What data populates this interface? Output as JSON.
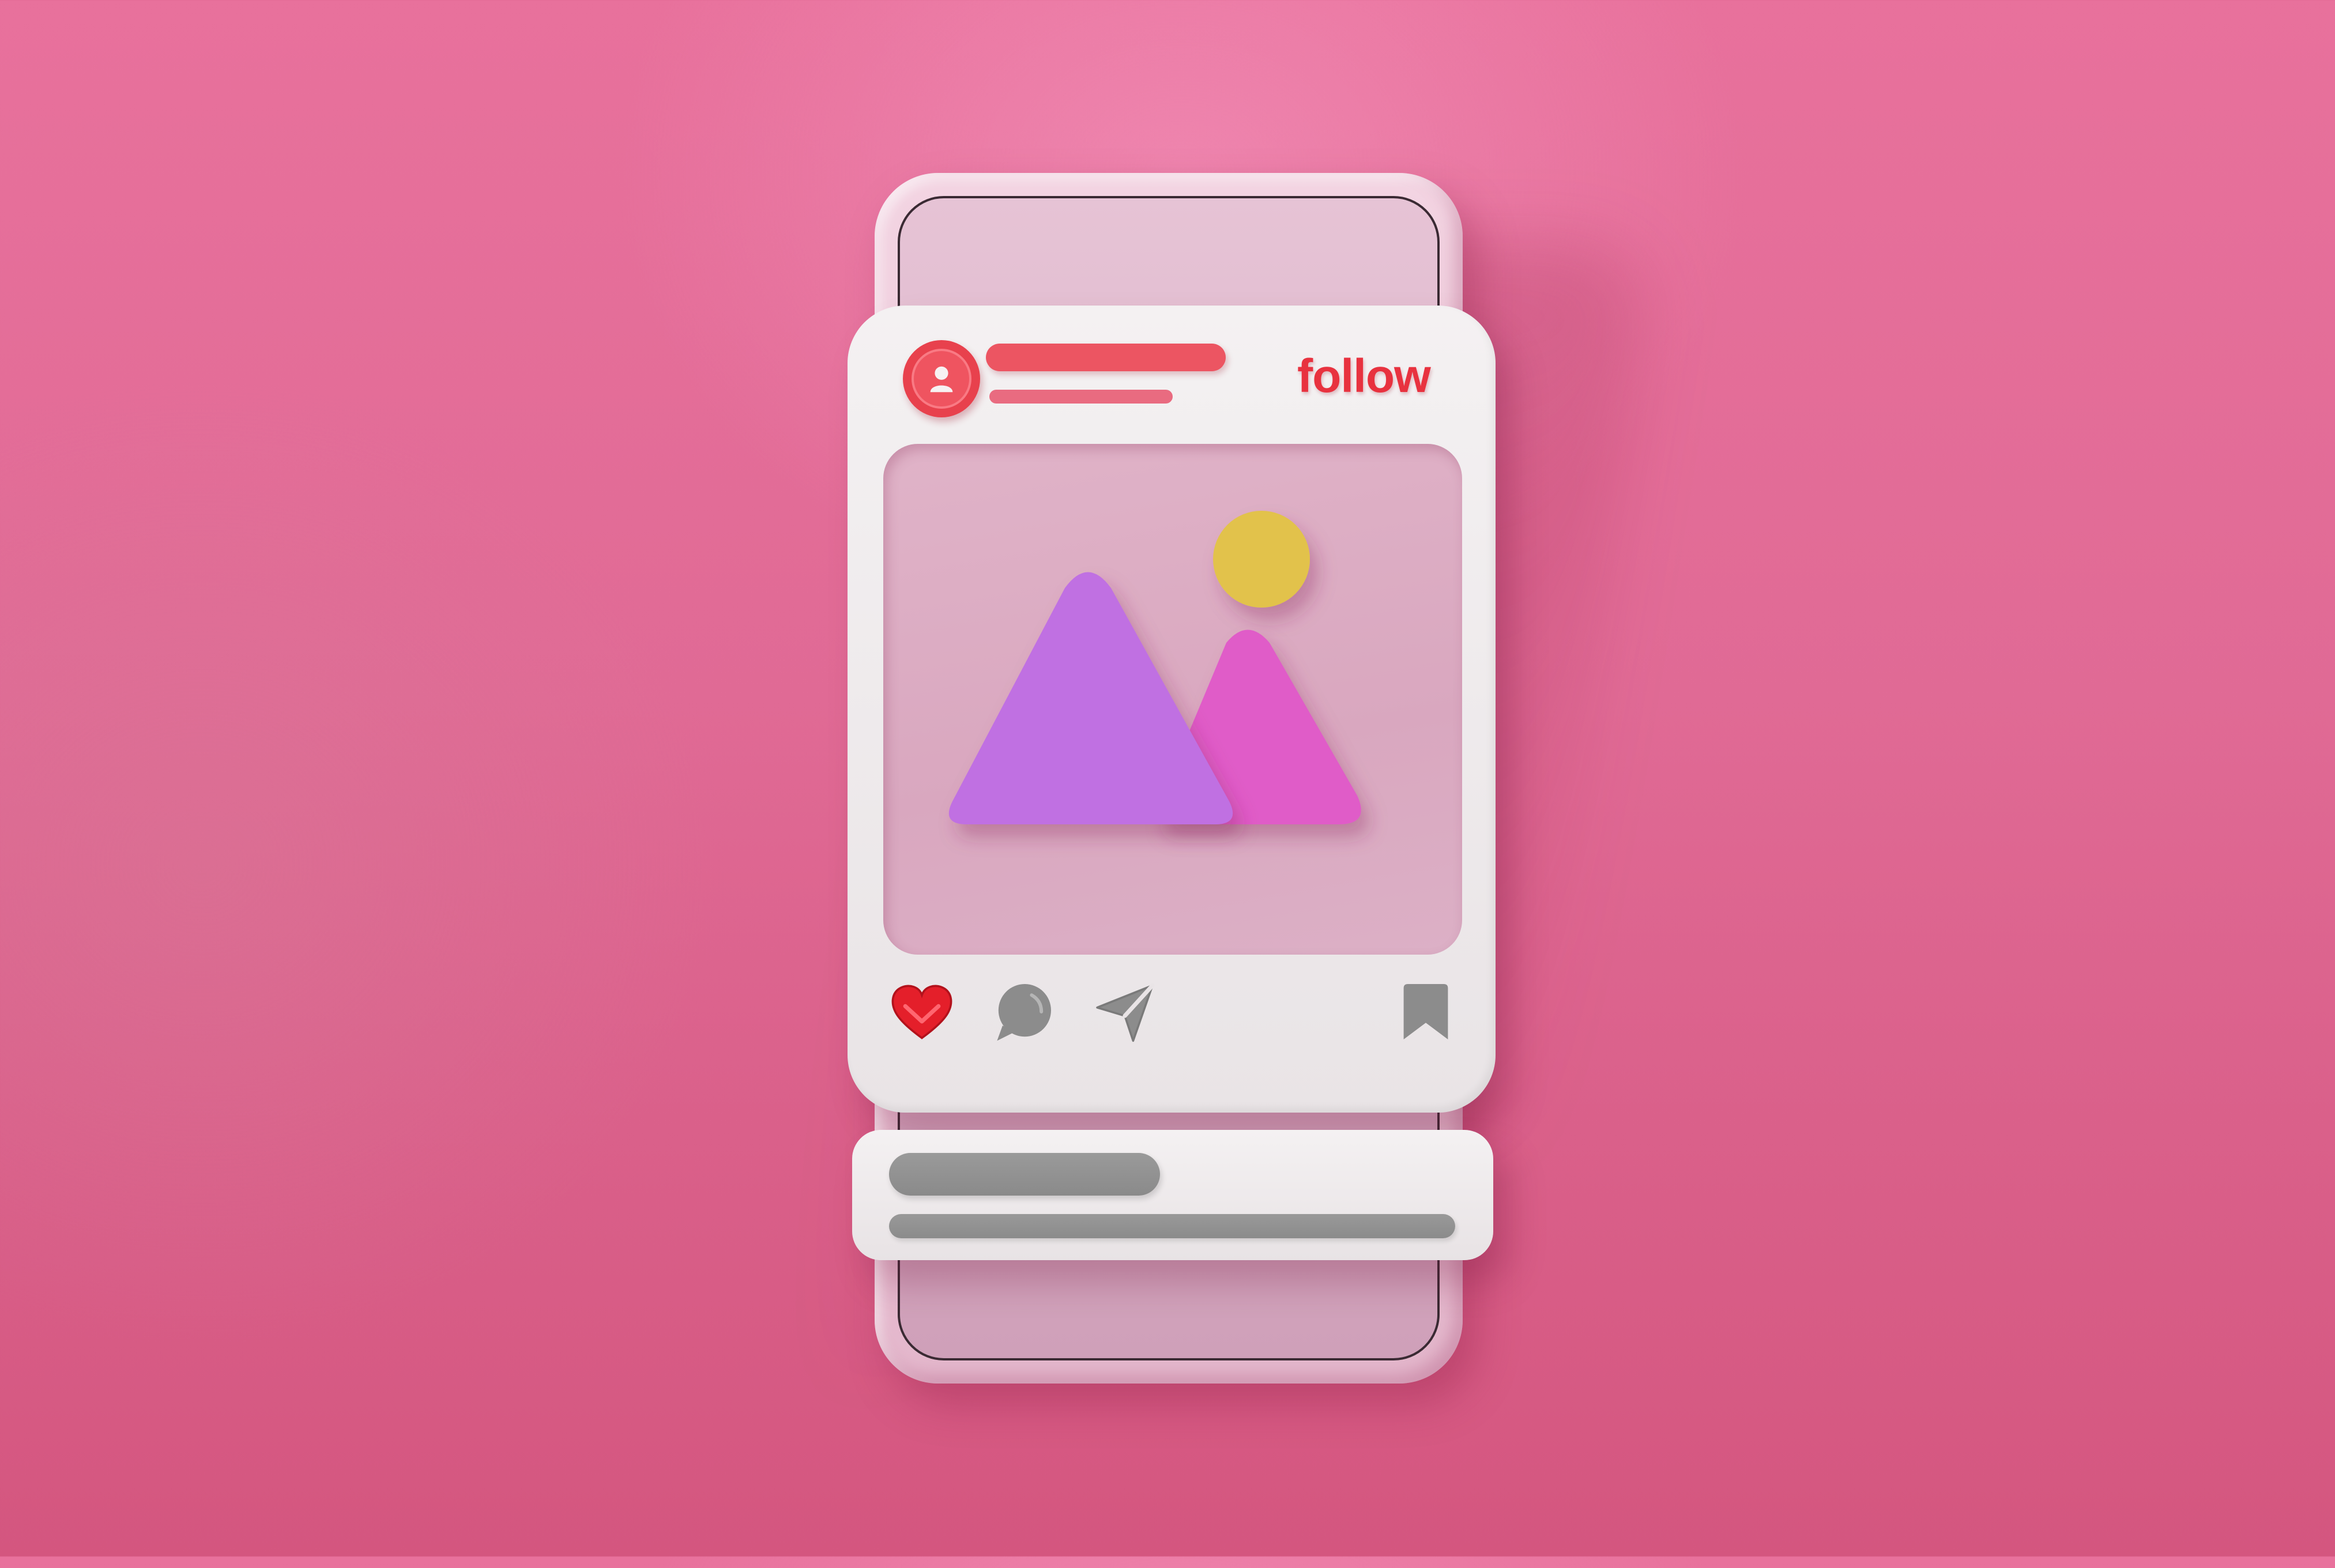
{
  "post": {
    "avatar_icon": "user-avatar-icon",
    "follow_label": "follow",
    "image_icon": "image-placeholder-icon"
  },
  "actions": {
    "like_icon": "heart-icon",
    "comment_icon": "comment-bubble-icon",
    "share_icon": "send-icon",
    "save_icon": "bookmark-icon"
  },
  "colors": {
    "background": "#e06a95",
    "accent": "#e8323f",
    "card": "#f2eff0",
    "mountain_primary": "#c070e2",
    "mountain_secondary": "#e05cc8",
    "sun": "#e2c24c",
    "icon_gray": "#8c8c8c"
  }
}
